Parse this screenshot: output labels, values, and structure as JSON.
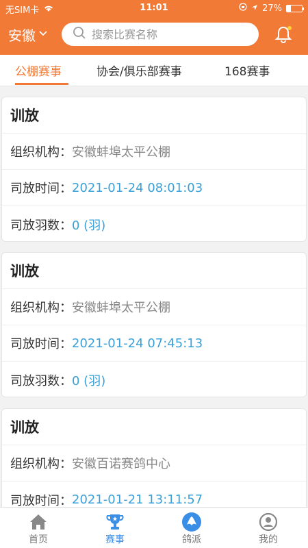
{
  "status": {
    "carrier": "无SIM卡",
    "time": "11:01",
    "battery": "27%",
    "battery_level": 0.27
  },
  "header": {
    "region": "安徽",
    "search_placeholder": "搜索比赛名称"
  },
  "tabs": [
    {
      "label": "公棚赛事",
      "active": true
    },
    {
      "label": "协会/俱乐部赛事",
      "active": false
    },
    {
      "label": "168赛事",
      "active": false
    }
  ],
  "cards": [
    {
      "title": "训放",
      "org_label": "组织机构：",
      "org": "安徽蚌埠太平公棚",
      "time_label": "司放时间：",
      "time": "2021-01-24 08:01:03",
      "count_label": "司放羽数：",
      "count": "0 (羽)"
    },
    {
      "title": "训放",
      "org_label": "组织机构：",
      "org": "安徽蚌埠太平公棚",
      "time_label": "司放时间：",
      "time": "2021-01-24 07:45:13",
      "count_label": "司放羽数：",
      "count": "0 (羽)"
    },
    {
      "title": "训放",
      "org_label": "组织机构：",
      "org": "安徽百诺赛鸽中心",
      "time_label": "司放时间：",
      "time": "2021-01-21 13:11:57"
    }
  ],
  "nav": [
    {
      "label": "首页",
      "icon": "home-icon"
    },
    {
      "label": "赛事",
      "icon": "trophy-icon",
      "active": true
    },
    {
      "label": "鸽派",
      "icon": "pigeon-icon"
    },
    {
      "label": "我的",
      "icon": "user-icon"
    }
  ],
  "colors": {
    "primary": "#f07a36",
    "accent_blue": "#3aa0d8",
    "nav_active": "#3a8ee6"
  }
}
